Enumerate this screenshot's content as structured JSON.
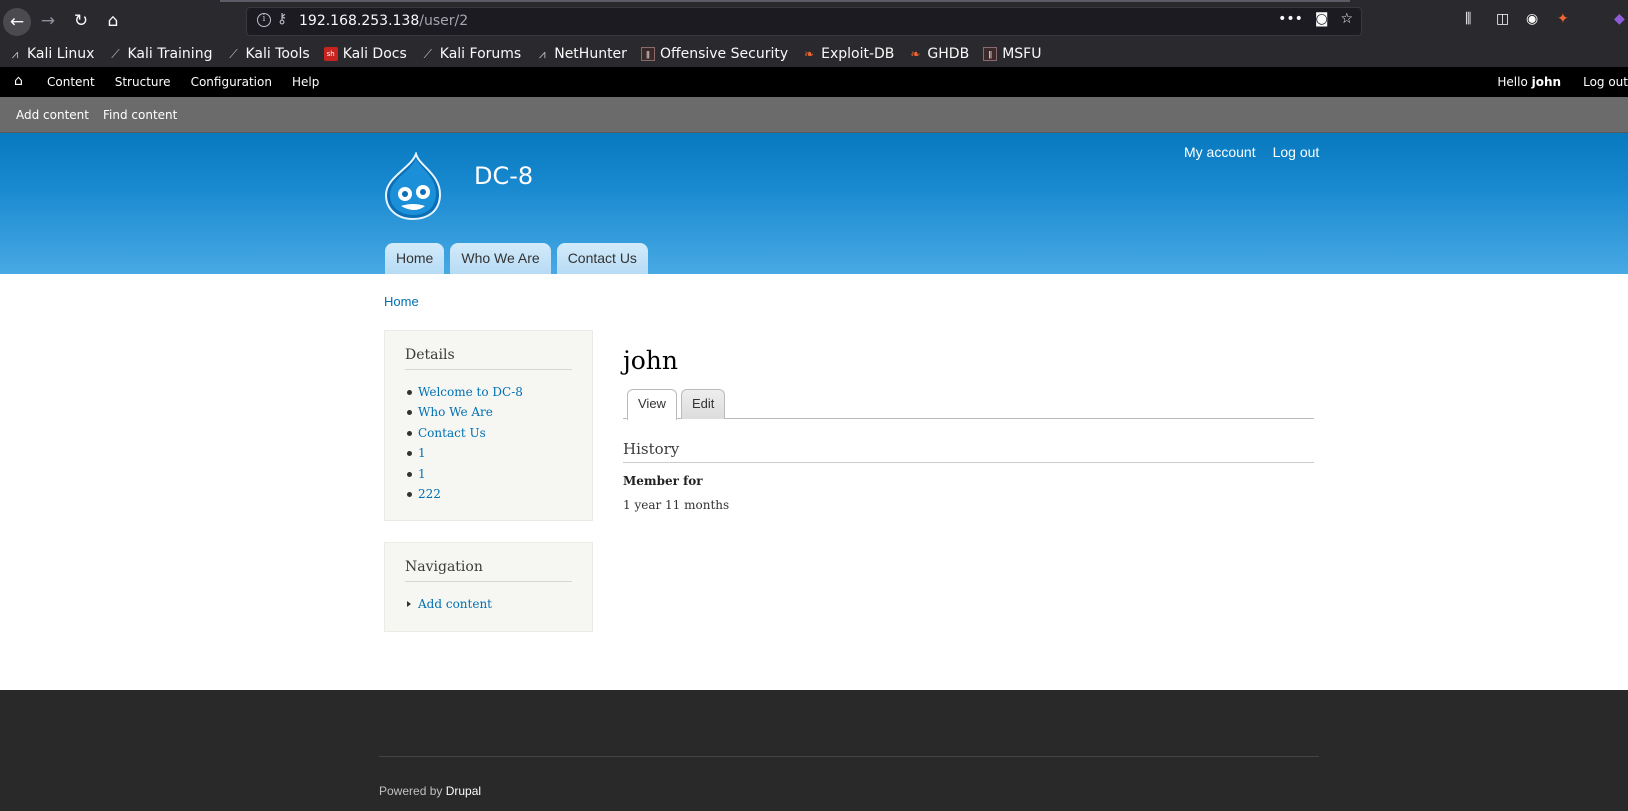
{
  "browser": {
    "url_host": "192.168.253.138",
    "url_path": "/user/2",
    "bookmarks": [
      {
        "label": "Kali Linux",
        "icon": "kali-icon"
      },
      {
        "label": "Kali Training",
        "icon": "kali-icon"
      },
      {
        "label": "Kali Tools",
        "icon": "kali-icon"
      },
      {
        "label": "Kali Docs",
        "icon": "kali-docs-icon"
      },
      {
        "label": "Kali Forums",
        "icon": "kali-icon"
      },
      {
        "label": "NetHunter",
        "icon": "nethunter-icon"
      },
      {
        "label": "Offensive Security",
        "icon": "offsec-icon"
      },
      {
        "label": "Exploit-DB",
        "icon": "exploitdb-icon"
      },
      {
        "label": "GHDB",
        "icon": "ghdb-icon"
      },
      {
        "label": "MSFU",
        "icon": "offsec-icon"
      }
    ]
  },
  "toolbar": {
    "menu": [
      "Content",
      "Structure",
      "Configuration",
      "Help"
    ],
    "hello": "Hello",
    "username": "john",
    "logout": "Log out",
    "shortcuts": [
      "Add content",
      "Find content"
    ]
  },
  "header": {
    "site_name": "DC-8",
    "secondary_menu": [
      "My account",
      "Log out"
    ],
    "main_menu": [
      "Home",
      "Who We Are",
      "Contact Us"
    ]
  },
  "breadcrumb": "Home",
  "sidebar": {
    "details": {
      "title": "Details",
      "items": [
        "Welcome to DC-8",
        "Who We Are",
        "Contact Us",
        "1",
        "1",
        "222"
      ]
    },
    "navigation": {
      "title": "Navigation",
      "items": [
        "Add content"
      ]
    }
  },
  "main": {
    "title": "john",
    "tabs": [
      "View",
      "Edit"
    ],
    "history_title": "History",
    "member_for_label": "Member for",
    "member_for_value": "1 year 11 months"
  },
  "footer": {
    "powered_by": "Powered by",
    "drupal": "Drupal"
  },
  "colors": {
    "link": "#0071b3",
    "header_top": "#0779bf",
    "header_bottom": "#48a9e4",
    "footer_bg": "#292929"
  }
}
